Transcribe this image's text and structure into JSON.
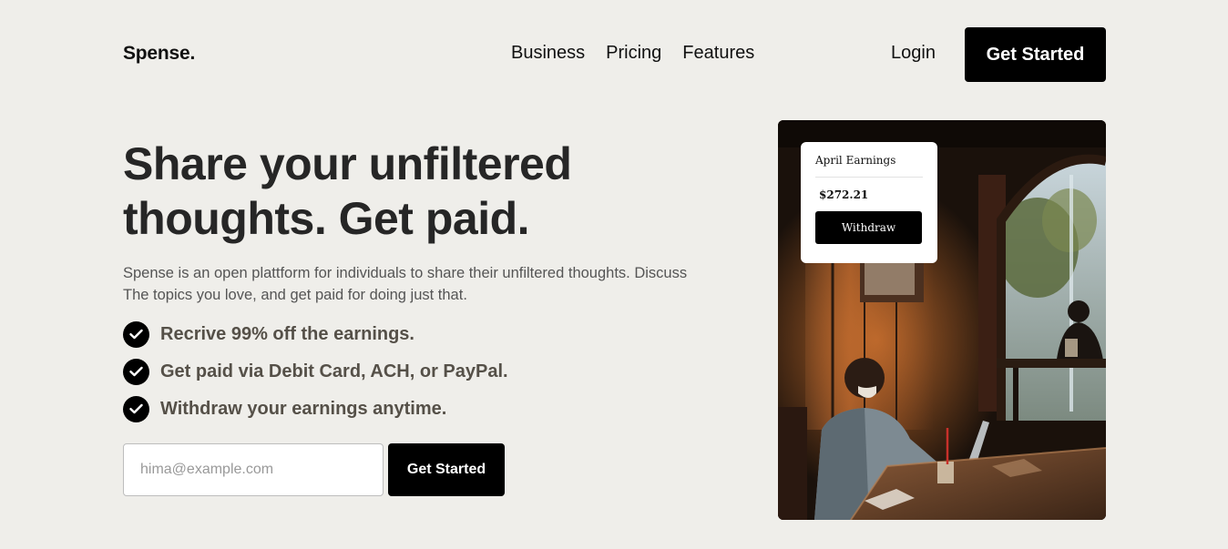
{
  "header": {
    "logo": "Spense.",
    "nav": [
      {
        "label": "Business"
      },
      {
        "label": "Pricing"
      },
      {
        "label": "Features"
      }
    ],
    "login_label": "Login",
    "cta_label": "Get Started"
  },
  "hero": {
    "title_line1": "Share your unfiltered",
    "title_line2": "thoughts. Get paid.",
    "description_line1": "Spense is an open plattform for individuals to share their unfiltered thoughts. Discuss",
    "description_line2": "The topics you love, and get paid for doing just that.",
    "features": [
      {
        "text": "Recrive 99% off the earnings."
      },
      {
        "text": "Get paid via Debit Card, ACH, or PayPal."
      },
      {
        "text": "Withdraw your earnings anytime."
      }
    ],
    "email_placeholder": "hima@example.com",
    "email_value": "",
    "form_cta_label": "Get Started"
  },
  "earnings_card": {
    "label": "April Earnings",
    "amount": "$272.21",
    "withdraw_label": "Withdraw"
  },
  "colors": {
    "background": "#efeeea",
    "primary_button": "#000000",
    "heading_text": "#262626",
    "feature_text": "#555048"
  },
  "icons": {
    "feature_check": "check-circle-icon"
  }
}
